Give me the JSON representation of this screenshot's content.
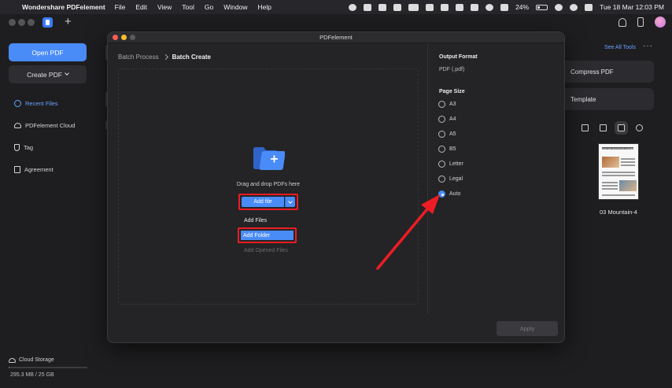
{
  "menubar": {
    "app_name": "Wondershare PDFelement",
    "items": [
      "File",
      "Edit",
      "View",
      "Tool",
      "Go",
      "Window",
      "Help"
    ],
    "battery": "24%",
    "battery_level": 0.24,
    "clock": "Tue 18 Mar  12:03 PM"
  },
  "sidebar": {
    "open_pdf": "Open PDF",
    "create_pdf": "Create PDF",
    "nav": [
      {
        "label": "Recent Files",
        "icon": "clock-icon",
        "active": true
      },
      {
        "label": "PDFelement Cloud",
        "icon": "cloud-icon",
        "active": false
      },
      {
        "label": "Tag",
        "icon": "tag-icon",
        "active": false
      },
      {
        "label": "Agreement",
        "icon": "document-icon",
        "active": false
      }
    ],
    "storage_label": "Cloud Storage",
    "storage_size": "295.3 MB / 25 GB",
    "storage_used_fraction": 0.012
  },
  "main": {
    "see_all_tools": "See All Tools",
    "tools": [
      "Compress PDF",
      "Template"
    ],
    "recent_file": {
      "name": "03 Mountain-4",
      "heading": "HOW ARE MOUNTAINS FORMED?"
    }
  },
  "dialog": {
    "title": "PDFelement",
    "breadcrumb_parent": "Batch Process",
    "breadcrumb_current": "Batch Create",
    "drop_text": "Drag and drop PDFs here",
    "add_file": "Add file",
    "dropdown": {
      "items": [
        "Add Files",
        "Add Folder",
        "Add Opened Files"
      ],
      "highlighted": "Add Folder",
      "disabled": "Add Opened Files"
    },
    "output_format_label": "Output Format",
    "output_format_value": "PDF (.pdf)",
    "page_size_label": "Page Size",
    "page_sizes": [
      "A3",
      "A4",
      "A5",
      "B5",
      "Letter",
      "Legal",
      "Auto"
    ],
    "selected_page_size": "Auto",
    "apply": "Apply"
  },
  "colors": {
    "accent": "#4a8cf7",
    "highlight": "#ee1c24",
    "link": "#6aa1ff"
  }
}
